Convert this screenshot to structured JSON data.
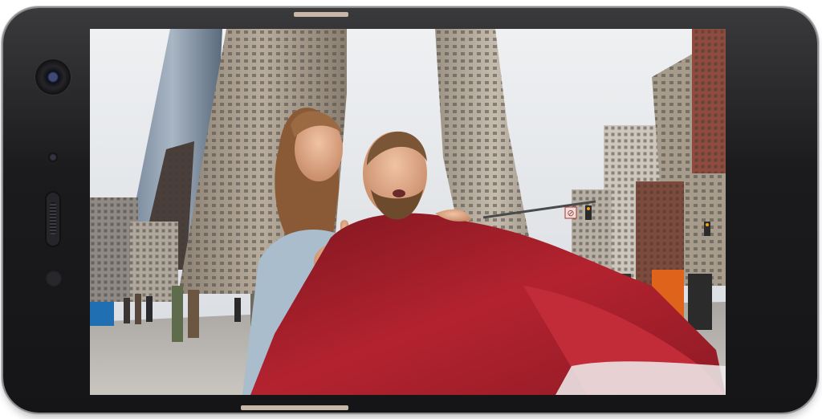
{
  "device": {
    "type": "smartphone-landscape",
    "frame_color": "#1c1c1e",
    "trim_color": "#c8b6a6"
  },
  "screen": {
    "content": "photo",
    "scene_colors": {
      "sky": "#e3e5e8",
      "jacket": "#a8202c",
      "hair": "#8a5a36"
    }
  },
  "signs": {
    "no_turn": "⊘"
  }
}
